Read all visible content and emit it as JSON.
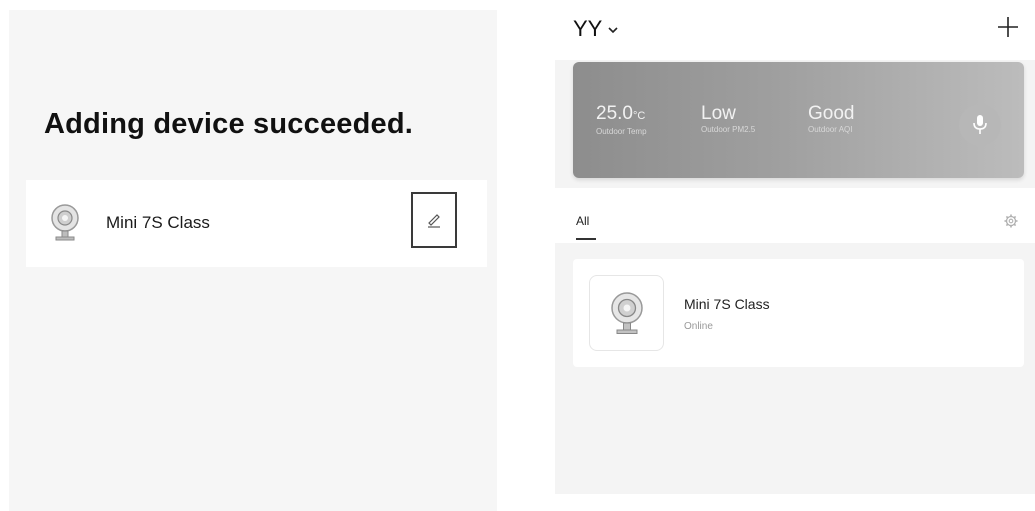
{
  "left": {
    "title": "Adding device succeeded.",
    "device": {
      "name": "Mini 7S Class",
      "icon": "camera-icon",
      "edit_icon": "pencil-icon"
    }
  },
  "right": {
    "home": {
      "name": "YY",
      "dropdown_icon": "chevron-down-icon",
      "add_icon": "plus-icon"
    },
    "weather": {
      "temp": {
        "value": "25.0",
        "unit": "°C",
        "label": "Outdoor Temp"
      },
      "pm25": {
        "value": "Low",
        "label": "Outdoor PM2.5"
      },
      "aqi": {
        "value": "Good",
        "label": "Outdoor AQI"
      },
      "mic_icon": "microphone-icon"
    },
    "tabs": [
      {
        "label": "All",
        "active": true
      }
    ],
    "settings_icon": "gear-icon",
    "devices": [
      {
        "name": "Mini 7S Class",
        "status": "Online",
        "icon": "camera-icon"
      }
    ]
  },
  "colors": {
    "banner": "#9a9a9a",
    "panel_bg": "#f6f6f6",
    "edit_border": "#3a3a3a"
  }
}
